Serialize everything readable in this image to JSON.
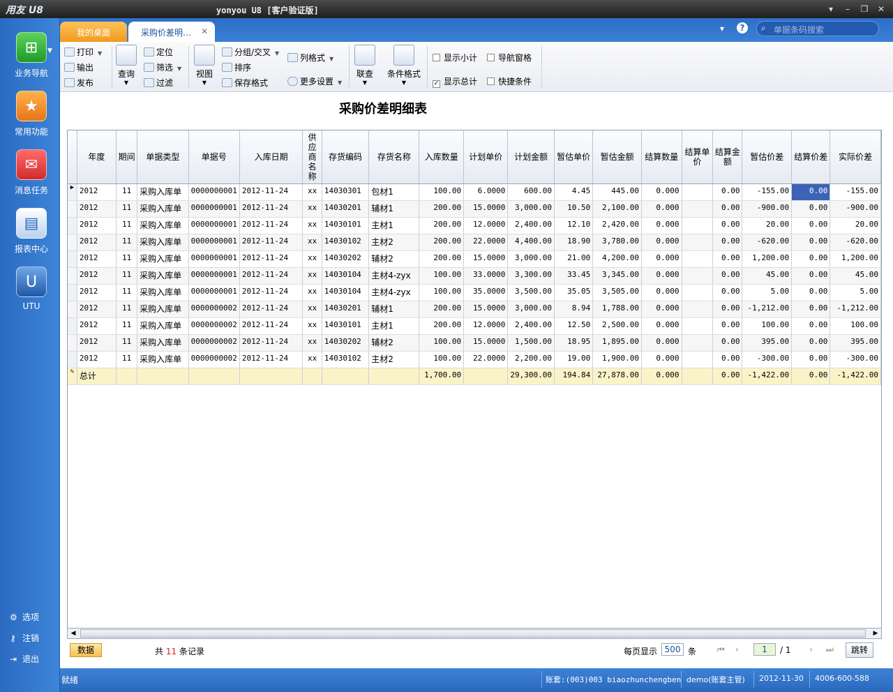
{
  "window": {
    "logo": "用友 U8",
    "title": "yonyou U8 [客户验证版]"
  },
  "sidebar": {
    "items": [
      {
        "label": "业务导航",
        "icon": "tree-nav-icon"
      },
      {
        "label": "常用功能",
        "icon": "star-icon"
      },
      {
        "label": "消息任务",
        "icon": "mail-icon"
      },
      {
        "label": "报表中心",
        "icon": "report-icon"
      },
      {
        "label": "UTU",
        "icon": "utu-icon"
      }
    ],
    "bottom": [
      {
        "label": "选项",
        "icon": "gear-icon"
      },
      {
        "label": "注销",
        "icon": "key-icon"
      },
      {
        "label": "退出",
        "icon": "exit-icon"
      }
    ]
  },
  "tabs": [
    {
      "label": "我的桌面"
    },
    {
      "label": "采购价差明…"
    }
  ],
  "search": {
    "placeholder": "单据条码搜索"
  },
  "toolbar": {
    "print": "打印",
    "export": "输出",
    "publish": "发布",
    "query": "查询",
    "locate": "定位",
    "filter": "筛选",
    "refine": "过滤",
    "view": "视图",
    "group": "分组/交叉",
    "sort": "排序",
    "save_format": "保存格式",
    "col_format": "列格式",
    "more_settings": "更多设置",
    "link_query": "联查",
    "cond_format": "条件格式",
    "show_subtotal": "显示小计",
    "show_total": "显示总计",
    "nav_pane": "导航窗格",
    "quick_cond": "快捷条件"
  },
  "report": {
    "title": "采购价差明细表",
    "columns": [
      "年度",
      "期间",
      "单据类型",
      "单据号",
      "入库日期",
      "供应商名称",
      "存货编码",
      "存货名称",
      "入库数量",
      "计划单价",
      "计划金额",
      "暂估单价",
      "暂估金额",
      "结算数量",
      "结算单价",
      "结算金额",
      "暂估价差",
      "结算价差",
      "实际价差"
    ],
    "rows": [
      [
        "2012",
        "11",
        "采购入库单",
        "0000000001",
        "2012-11-24",
        "xx",
        "14030301",
        "包材1",
        "100.00",
        "6.0000",
        "600.00",
        "4.45",
        "445.00",
        "0.000",
        "",
        "0.00",
        "-155.00",
        "0.00",
        "-155.00"
      ],
      [
        "2012",
        "11",
        "采购入库单",
        "0000000001",
        "2012-11-24",
        "xx",
        "14030201",
        "辅材1",
        "200.00",
        "15.0000",
        "3,000.00",
        "10.50",
        "2,100.00",
        "0.000",
        "",
        "0.00",
        "-900.00",
        "0.00",
        "-900.00"
      ],
      [
        "2012",
        "11",
        "采购入库单",
        "0000000001",
        "2012-11-24",
        "xx",
        "14030101",
        "主材1",
        "200.00",
        "12.0000",
        "2,400.00",
        "12.10",
        "2,420.00",
        "0.000",
        "",
        "0.00",
        "20.00",
        "0.00",
        "20.00"
      ],
      [
        "2012",
        "11",
        "采购入库单",
        "0000000001",
        "2012-11-24",
        "xx",
        "14030102",
        "主材2",
        "200.00",
        "22.0000",
        "4,400.00",
        "18.90",
        "3,780.00",
        "0.000",
        "",
        "0.00",
        "-620.00",
        "0.00",
        "-620.00"
      ],
      [
        "2012",
        "11",
        "采购入库单",
        "0000000001",
        "2012-11-24",
        "xx",
        "14030202",
        "辅材2",
        "200.00",
        "15.0000",
        "3,000.00",
        "21.00",
        "4,200.00",
        "0.000",
        "",
        "0.00",
        "1,200.00",
        "0.00",
        "1,200.00"
      ],
      [
        "2012",
        "11",
        "采购入库单",
        "0000000001",
        "2012-11-24",
        "xx",
        "14030104",
        "主材4-zyx",
        "100.00",
        "33.0000",
        "3,300.00",
        "33.45",
        "3,345.00",
        "0.000",
        "",
        "0.00",
        "45.00",
        "0.00",
        "45.00"
      ],
      [
        "2012",
        "11",
        "采购入库单",
        "0000000001",
        "2012-11-24",
        "xx",
        "14030104",
        "主材4-zyx",
        "100.00",
        "35.0000",
        "3,500.00",
        "35.05",
        "3,505.00",
        "0.000",
        "",
        "0.00",
        "5.00",
        "0.00",
        "5.00"
      ],
      [
        "2012",
        "11",
        "采购入库单",
        "0000000002",
        "2012-11-24",
        "xx",
        "14030201",
        "辅材1",
        "200.00",
        "15.0000",
        "3,000.00",
        "8.94",
        "1,788.00",
        "0.000",
        "",
        "0.00",
        "-1,212.00",
        "0.00",
        "-1,212.00"
      ],
      [
        "2012",
        "11",
        "采购入库单",
        "0000000002",
        "2012-11-24",
        "xx",
        "14030101",
        "主材1",
        "200.00",
        "12.0000",
        "2,400.00",
        "12.50",
        "2,500.00",
        "0.000",
        "",
        "0.00",
        "100.00",
        "0.00",
        "100.00"
      ],
      [
        "2012",
        "11",
        "采购入库单",
        "0000000002",
        "2012-11-24",
        "xx",
        "14030202",
        "辅材2",
        "100.00",
        "15.0000",
        "1,500.00",
        "18.95",
        "1,895.00",
        "0.000",
        "",
        "0.00",
        "395.00",
        "0.00",
        "395.00"
      ],
      [
        "2012",
        "11",
        "采购入库单",
        "0000000002",
        "2012-11-24",
        "xx",
        "14030102",
        "主材2",
        "100.00",
        "22.0000",
        "2,200.00",
        "19.00",
        "1,900.00",
        "0.000",
        "",
        "0.00",
        "-300.00",
        "0.00",
        "-300.00"
      ]
    ],
    "total": [
      "总计",
      "",
      "",
      "",
      "",
      "",
      "",
      "",
      "1,700.00",
      "",
      "29,300.00",
      "194.84",
      "27,878.00",
      "0.000",
      "",
      "0.00",
      "-1,422.00",
      "0.00",
      "-1,422.00"
    ]
  },
  "pager": {
    "data_btn": "数据",
    "count_pre": "共",
    "count": "11",
    "count_post": "条记录",
    "per_page_label": "每页显示",
    "per_page": "500",
    "per_page_unit": "条",
    "page": "1",
    "page_total": "/ 1",
    "jump": "跳转"
  },
  "status": {
    "ready": "就绪",
    "account": "账套:(003)003 biaozhunchengben",
    "user": "demo(账套主管)",
    "date": "2012-11-30",
    "phone": "4006-600-588"
  }
}
